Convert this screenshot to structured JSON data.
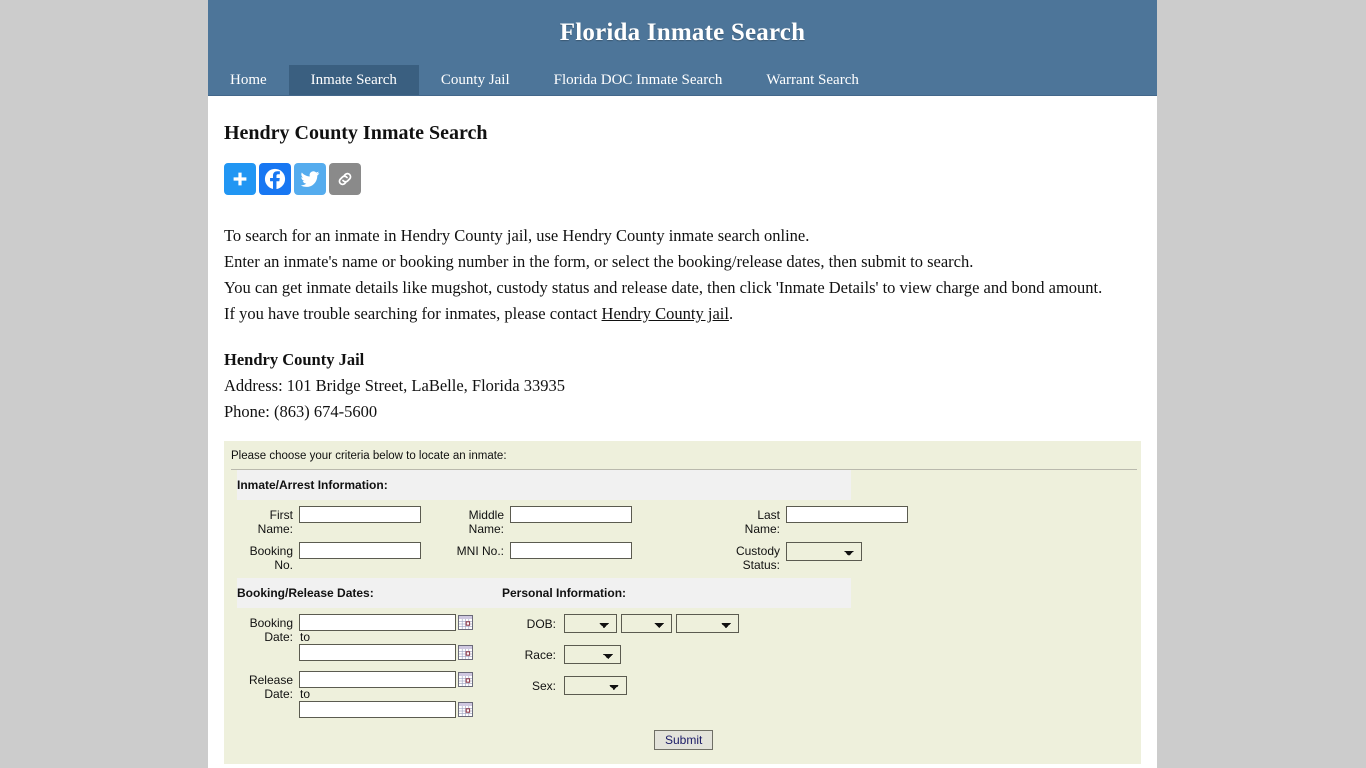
{
  "site": {
    "title": "Florida Inmate Search",
    "header_bg": "#4d7599",
    "nav_active_bg": "#3a5f80"
  },
  "nav": {
    "items": [
      {
        "label": "Home",
        "active": false
      },
      {
        "label": "Inmate Search",
        "active": true
      },
      {
        "label": "County Jail",
        "active": false
      },
      {
        "label": "Florida DOC Inmate Search",
        "active": false
      },
      {
        "label": "Warrant Search",
        "active": false
      }
    ]
  },
  "page": {
    "title": "Hendry County Inmate Search"
  },
  "share": {
    "buttons": [
      {
        "icon": "addthis-plus-icon",
        "label": "Share",
        "color": "#2196f3"
      },
      {
        "icon": "facebook-icon",
        "label": "Facebook",
        "color": "#1877f2"
      },
      {
        "icon": "twitter-icon",
        "label": "Twitter",
        "color": "#55acee"
      },
      {
        "icon": "copy-link-icon",
        "label": "Copy Link",
        "color": "#8a8a8a"
      }
    ]
  },
  "intro": {
    "line1": "To search for an inmate in Hendry County jail, use Hendry County inmate search online.",
    "line2": "Enter an inmate's name or booking number in the form, or select the booking/release dates, then submit to search.",
    "line3": "You can get inmate details like mugshot, custody status and release date, then click 'Inmate Details' to view charge and bond amount.",
    "line4_prefix": "If you have trouble searching for inmates, please contact ",
    "line4_link": "Hendry County jail",
    "line4_suffix": "."
  },
  "jail": {
    "name": "Hendry County Jail",
    "address": "Address: 101 Bridge Street, LaBelle, Florida 33935",
    "phone": "Phone: (863) 674-5600"
  },
  "form": {
    "intro": "Please choose your criteria below to locate an inmate:",
    "sections": {
      "inmate_arrest": "Inmate/Arrest Information:",
      "booking_release": "Booking/Release Dates:",
      "personal": "Personal Information:"
    },
    "labels": {
      "first_name": "First Name:",
      "middle_name": "Middle Name:",
      "last_name": "Last Name:",
      "booking_no": "Booking No.",
      "mni_no": "MNI No.:",
      "custody_status": "Custody Status:",
      "booking_date": "Booking Date:",
      "release_date": "Release Date:",
      "to": "to",
      "dob": "DOB:",
      "race": "Race:",
      "sex": "Sex:"
    },
    "values": {
      "first_name": "",
      "middle_name": "",
      "last_name": "",
      "booking_no": "",
      "mni_no": "",
      "custody_status": "",
      "booking_date_from": "",
      "booking_date_to": "",
      "release_date_from": "",
      "release_date_to": "",
      "dob_month": "",
      "dob_day": "",
      "dob_year": "",
      "race": "",
      "sex": ""
    },
    "placeholders": {
      "first_name": "",
      "middle_name": "",
      "last_name": "",
      "booking_no": "",
      "mni_no": "",
      "booking_date_from": "",
      "booking_date_to": "",
      "release_date_from": "",
      "release_date_to": ""
    },
    "submit_label": "Submit",
    "panel_bg": "#eef0dc",
    "section_bar_bg": "#f1f1f1",
    "calendar_icon": "calendar-picker-icon"
  }
}
